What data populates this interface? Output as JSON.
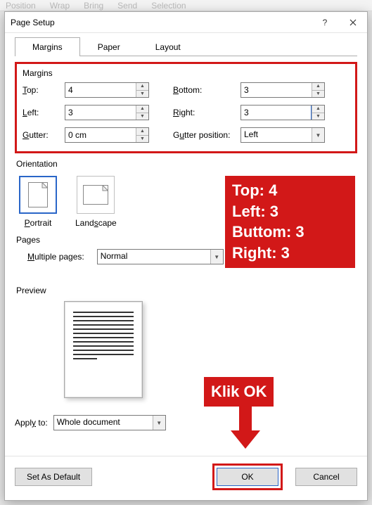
{
  "ribbon": {
    "items": [
      "Position",
      "Wrap",
      "Bring",
      "Send",
      "Selection"
    ]
  },
  "title": "Page Setup",
  "tabs": {
    "margins": "Margins",
    "paper": "Paper",
    "layout": "Layout"
  },
  "margins": {
    "legend": "Margins",
    "top_label": "Top:",
    "top_value": "4",
    "bottom_label": "Bottom:",
    "bottom_value": "3",
    "left_label": "Left:",
    "left_value": "3",
    "right_label": "Right:",
    "right_value": "3",
    "gutter_label": "Gutter:",
    "gutter_value": "0 cm",
    "gutter_pos_label": "Gutter position:",
    "gutter_pos_value": "Left"
  },
  "orientation": {
    "legend": "Orientation",
    "portrait": "Portrait",
    "landscape": "Landscape"
  },
  "pages": {
    "legend": "Pages",
    "multiple_label": "Multiple pages:",
    "multiple_value": "Normal"
  },
  "preview": {
    "legend": "Preview"
  },
  "apply": {
    "label": "Apply to:",
    "value": "Whole document"
  },
  "buttons": {
    "default": "Set As Default",
    "ok": "OK",
    "cancel": "Cancel"
  },
  "annotations": {
    "box": "Top: 4\nLeft: 3\nButtom: 3\nRight: 3",
    "klik": "Klik OK"
  }
}
